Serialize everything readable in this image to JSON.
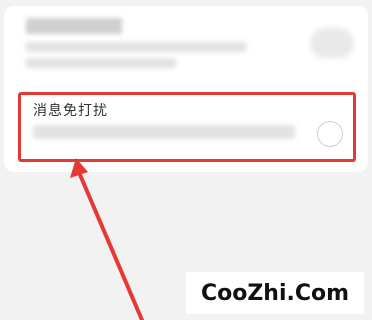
{
  "settings": {
    "dnd_label": "消息免打扰",
    "dnd_enabled": false
  },
  "watermark": {
    "text": "CooZhi.Com"
  },
  "colors": {
    "highlight": "#e53935",
    "background": "#f2f2f2",
    "card": "#ffffff"
  }
}
